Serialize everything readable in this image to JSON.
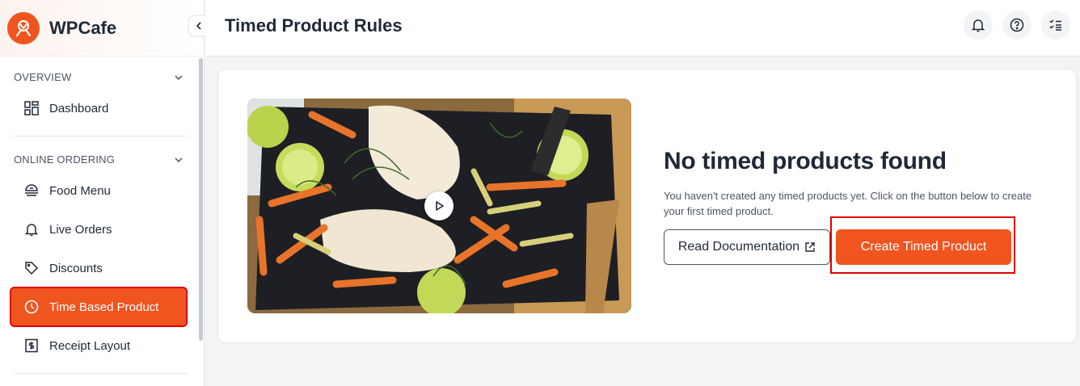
{
  "brand": {
    "name": "WPCafe",
    "accent": "#f0541f"
  },
  "sidebar": {
    "sections": [
      {
        "title": "OVERVIEW",
        "items": [
          {
            "label": "Dashboard",
            "icon": "dashboard-icon"
          }
        ]
      },
      {
        "title": "ONLINE ORDERING",
        "items": [
          {
            "label": "Food Menu",
            "icon": "food-menu-icon"
          },
          {
            "label": "Live Orders",
            "icon": "bell-icon"
          },
          {
            "label": "Discounts",
            "icon": "tag-icon"
          },
          {
            "label": "Time Based Product",
            "icon": "clock-icon",
            "active": true
          },
          {
            "label": "Receipt Layout",
            "icon": "receipt-icon"
          }
        ]
      }
    ]
  },
  "header": {
    "title": "Timed Product Rules",
    "actions": [
      "notification-bell-icon",
      "help-icon",
      "checklist-icon"
    ]
  },
  "empty_state": {
    "title": "No timed products found",
    "description": "You haven't created any timed products yet. Click on the button below to create your first timed product.",
    "doc_button": "Read Documentation",
    "create_button": "Create Timed Product"
  }
}
